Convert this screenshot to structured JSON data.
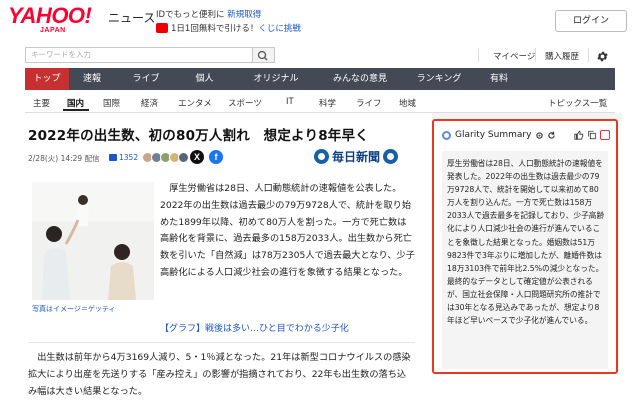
{
  "header": {
    "logo_main": "YAHOO!",
    "logo_sub": "JAPAN",
    "site_name": "ニュース",
    "promo_line1_prefix": "IDでもっと便利に",
    "promo_line1_link": "新規取得",
    "promo_line2_prefix": "1日1回無料で引ける！",
    "promo_line2_link": "くじに挑戦",
    "login_label": "ログイン"
  },
  "search": {
    "placeholder": "キーワードを入力",
    "links": [
      "マイページ",
      "購入履歴"
    ]
  },
  "main_nav": {
    "tabs": [
      "トップ",
      "速報",
      "ライブ",
      "個人",
      "オリジナル",
      "みんなの意見",
      "ランキング",
      "有料"
    ],
    "active_index": 0
  },
  "sub_nav": {
    "items": [
      "主要",
      "国内",
      "国際",
      "経済",
      "エンタメ",
      "スポーツ",
      "IT",
      "科学",
      "ライフ",
      "地域"
    ],
    "active_index": 1,
    "topics_link": "トピックス一覧"
  },
  "article": {
    "title": "2022年の出生数、初の80万人割れ　想定より8年早く",
    "date": "2/28(火) 14:29 配信",
    "comment_count": "1352",
    "publisher": "毎日新聞",
    "photo_caption": "写真はイメージ＝ゲッティ",
    "lead": "厚生労働省は28日、人口動態統計の速報値を公表した。2022年の出生数は過去最少の79万9728人で、統計を取り始めた1899年以降、初めて80万人を割った。一方で死亡数は高齢化を背景に、過去最多の158万2033人。出生数から死亡数を引いた「自然減」は78万2305人で過去最大となり、少子高齢化による人口減少社会の進行を象徴する結果となった。",
    "graph_link": "【グラフ】戦後は多い…ひと目でわかる少子化",
    "paragraph2": "出生数は前年から4万3169人減り、5・1％減となった。21年は新型コロナウイルスの感染拡大により出産を先送りする「産み控え」の影響が指摘されており、22年も出生数の落ち込み幅は大きい結果となった。"
  },
  "summary": {
    "title": "Glarity Summary",
    "text": "厚生労働省は28日、人口動態統計の速報値を発表した。2022年の出生数は過去最少の79万9728人で、統計を開始して以来初めて80万人を割り込んだ。一方で死亡数は158万2033人で過去最多を記録しており、少子高齢化により人口減少社会の進行が進んでいることを象徴した結果となった。婚姻数は51万9823件で3年ぶりに増加したが、離婚件数は18万3103件で前年比2.5%の減少となった。最終的なデータとして確定値が公表されるが、国立社会保障・人口問題研究所の推計では30年となる見込みであったが、想定より8年ほど早いペースで少子化が進んでいる。"
  },
  "colors": {
    "brand_red": "#ff0033",
    "nav_bg": "#444a55",
    "nav_active": "#c63030",
    "link_blue": "#1a57c8",
    "highlight_border": "#e8391e",
    "publisher_blue": "#0d3f85"
  }
}
